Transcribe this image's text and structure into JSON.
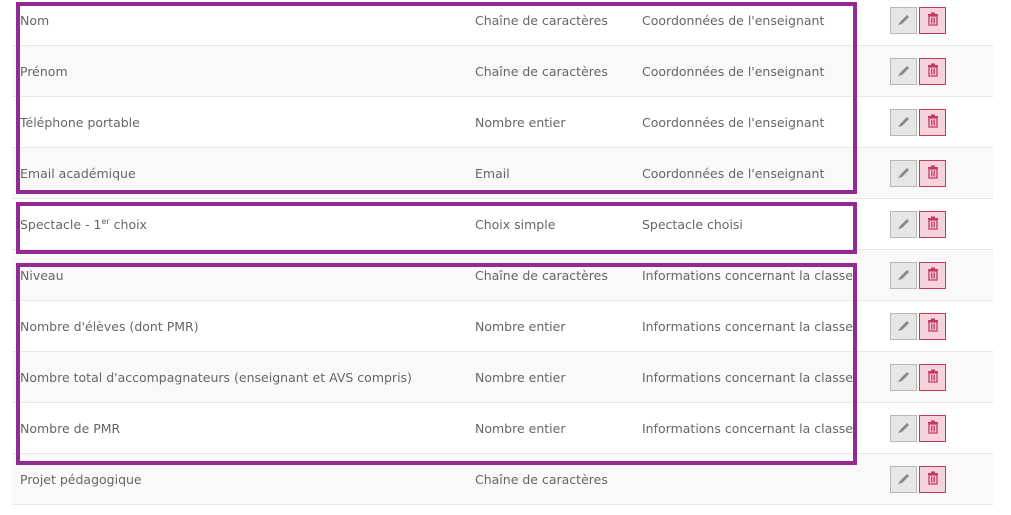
{
  "rows": [
    {
      "name": "Nom",
      "type": "Chaîne de caractères",
      "group": "Coordonnées de l'enseignant"
    },
    {
      "name": "Prénom",
      "type": "Chaîne de caractères",
      "group": "Coordonnées de l'enseignant"
    },
    {
      "name": "Téléphone portable",
      "type": "Nombre entier",
      "group": "Coordonnées de l'enseignant"
    },
    {
      "name": "Email académique",
      "type": "Email",
      "group": "Coordonnées de l'enseignant"
    },
    {
      "name": "Spectacle - 1",
      "name_sup": "er",
      "name_suffix": " choix",
      "type": "Choix simple",
      "group": "Spectacle choisi"
    },
    {
      "name": "Niveau",
      "type": "Chaîne de caractères",
      "group": "Informations concernant la classe"
    },
    {
      "name": "Nombre d'élèves (dont PMR)",
      "type": "Nombre entier",
      "group": "Informations concernant la classe"
    },
    {
      "name": "Nombre total d'accompagnateurs (enseignant et AVS compris)",
      "type": "Nombre entier",
      "group": "Informations concernant la classe"
    },
    {
      "name": "Nombre de PMR",
      "type": "Nombre entier",
      "group": "Informations concernant la classe"
    },
    {
      "name": "Projet pédagogique",
      "type": "Chaîne de caractères",
      "group": ""
    }
  ],
  "icons": {
    "edit": "pencil-icon",
    "delete": "trash-icon"
  },
  "colors": {
    "highlight": "#922a92",
    "delete": "#c23a5e",
    "delete_bg": "#f6d2da",
    "edit_bg": "#e6e6e6"
  }
}
